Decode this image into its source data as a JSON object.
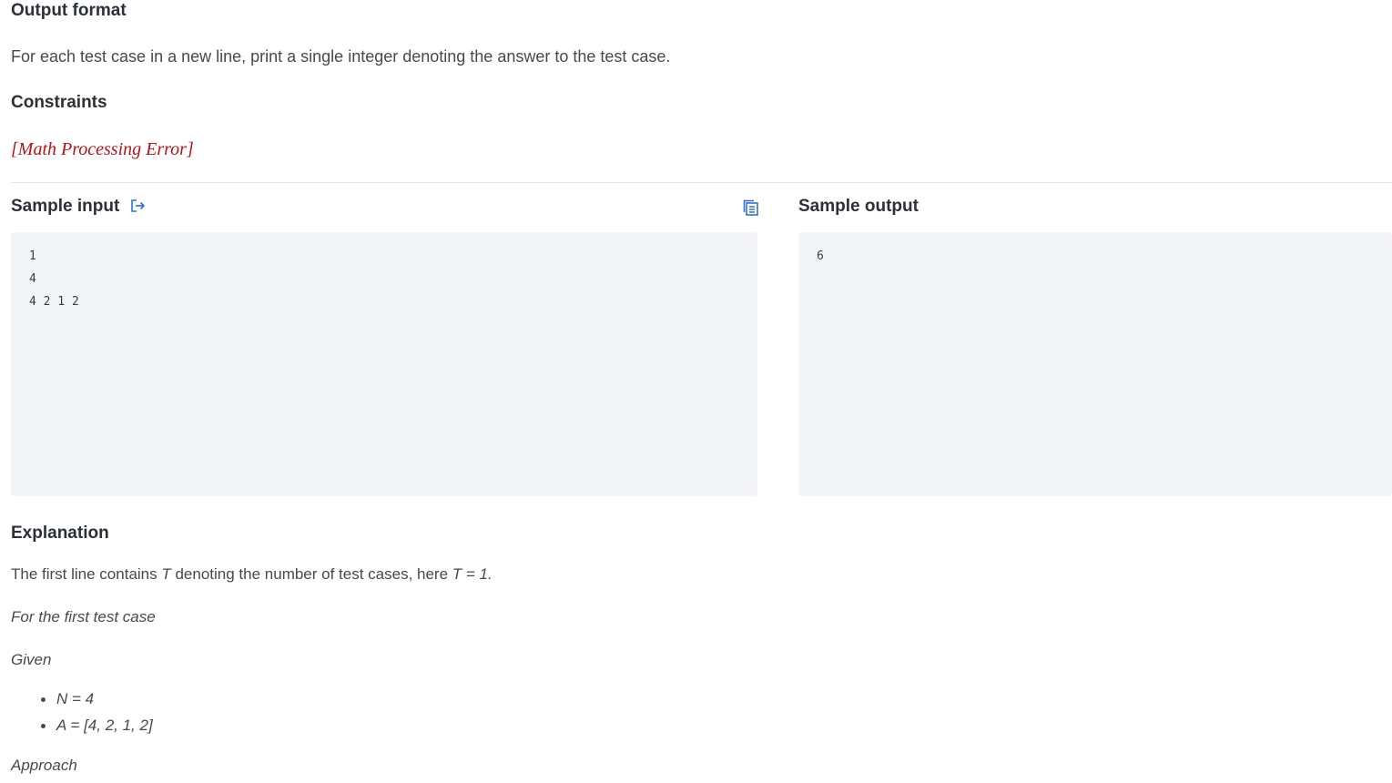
{
  "output_format": {
    "heading": "Output format",
    "text": "For each test case in a new line, print a single integer denoting the answer to the test case."
  },
  "constraints": {
    "heading": "Constraints",
    "math_error": "[Math Processing Error]"
  },
  "sample_input": {
    "heading": "Sample input",
    "icon": "open-in-editor-icon",
    "copy_icon": "copy-icon",
    "content": "1\n4\n4 2 1 2"
  },
  "sample_output": {
    "heading": "Sample output",
    "content": "6"
  },
  "explanation": {
    "heading": "Explanation",
    "line1_prefix": "The first line contains ",
    "line1_var": "T",
    "line1_middle": " denoting the number of test cases, here ",
    "line1_eq": "T = 1.",
    "first_case": "For the first test case",
    "given": "Given",
    "items": [
      "N = 4",
      "A = [4, 2, 1, 2]"
    ],
    "approach": "Approach"
  },
  "colors": {
    "accent": "#2f6fd6",
    "error": "#b3141a",
    "panel_bg": "#f3f4f7"
  }
}
